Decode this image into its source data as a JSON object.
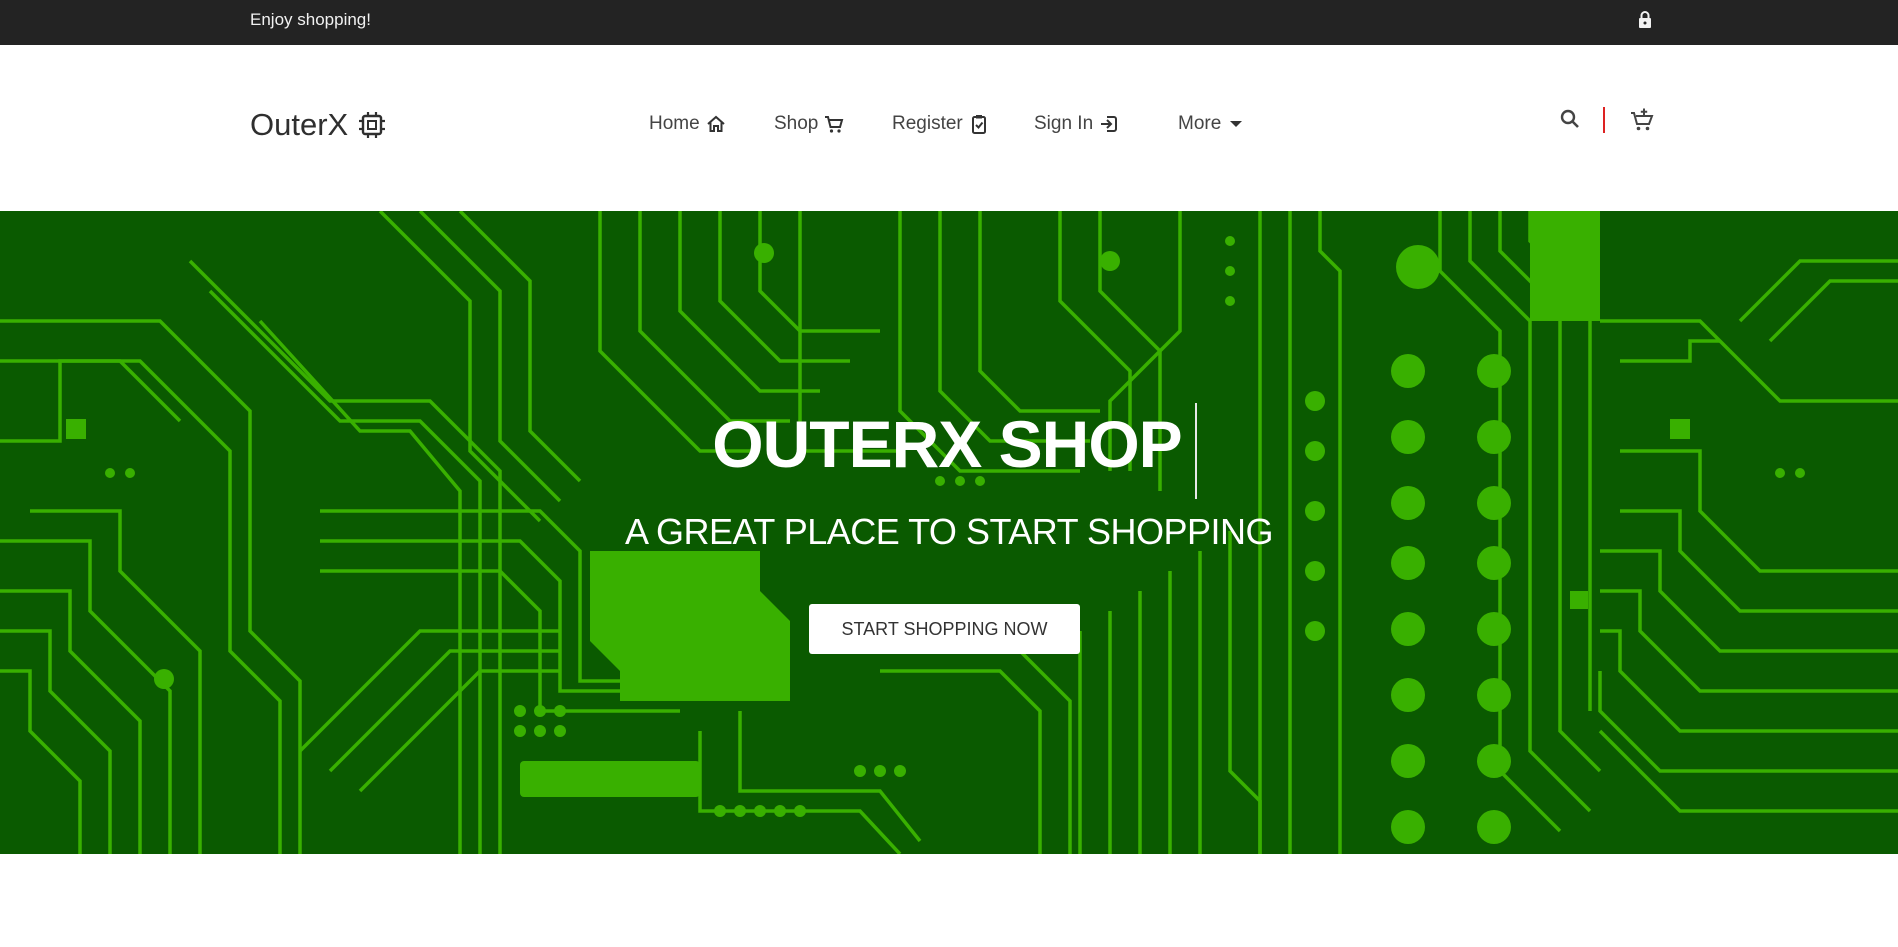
{
  "topbar": {
    "promo_text": "Enjoy shopping!",
    "lock_icon": "lock-icon"
  },
  "header": {
    "brand_name": "OuterX",
    "brand_icon": "chip-icon",
    "nav": [
      {
        "label": "Home",
        "icon": "home-icon"
      },
      {
        "label": "Shop",
        "icon": "cart-icon"
      },
      {
        "label": "Register",
        "icon": "clipboard-check-icon"
      },
      {
        "label": "Sign In",
        "icon": "sign-in-icon"
      },
      {
        "label": "More",
        "icon": "caret-down-icon"
      }
    ],
    "search_icon": "search-icon",
    "cart_icon": "cart-plus-icon"
  },
  "hero": {
    "title": "OUTERX SHOP",
    "subtitle": "A GREAT PLACE TO START SHOPPING",
    "cta_label": "START SHOPPING NOW"
  },
  "colors": {
    "topbar_bg": "#232323",
    "hero_dark_green": "#0a5a00",
    "hero_trace_green": "#39b000",
    "divider_red": "#d22222"
  }
}
